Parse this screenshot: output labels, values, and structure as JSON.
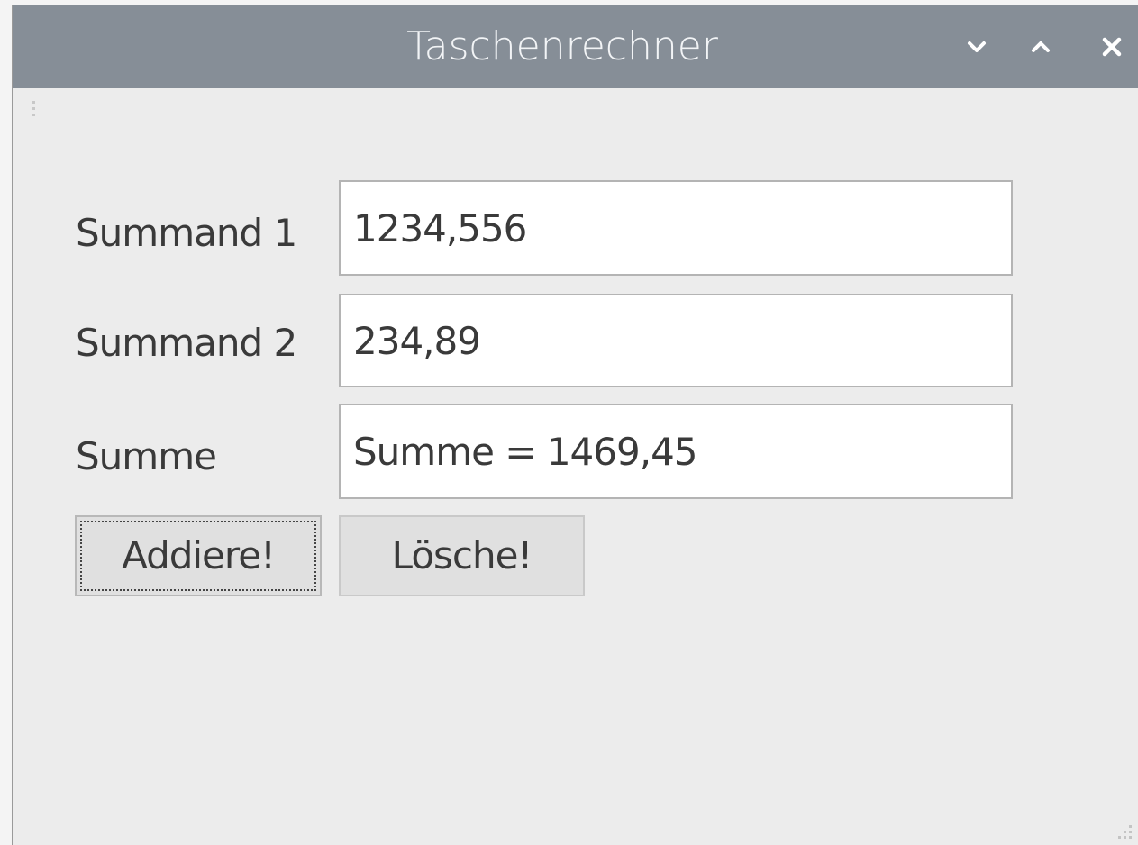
{
  "window": {
    "title": "Taschenrechner",
    "controls": {
      "minimize_icon": "chevron-down-icon",
      "maximize_icon": "chevron-up-icon",
      "close_icon": "close-icon"
    }
  },
  "form": {
    "summand1": {
      "label": "Summand 1",
      "value": "1234,556"
    },
    "summand2": {
      "label": "Summand 2",
      "value": "234,89"
    },
    "sum": {
      "label": "Summe",
      "value": "Summe = 1469,45"
    }
  },
  "buttons": {
    "add_label": "Addiere!",
    "clear_label": "Lösche!"
  },
  "colors": {
    "titlebar": "#868e97",
    "window_background": "#ececec",
    "field_background": "#ffffff",
    "button_background": "#e0e0e0"
  }
}
